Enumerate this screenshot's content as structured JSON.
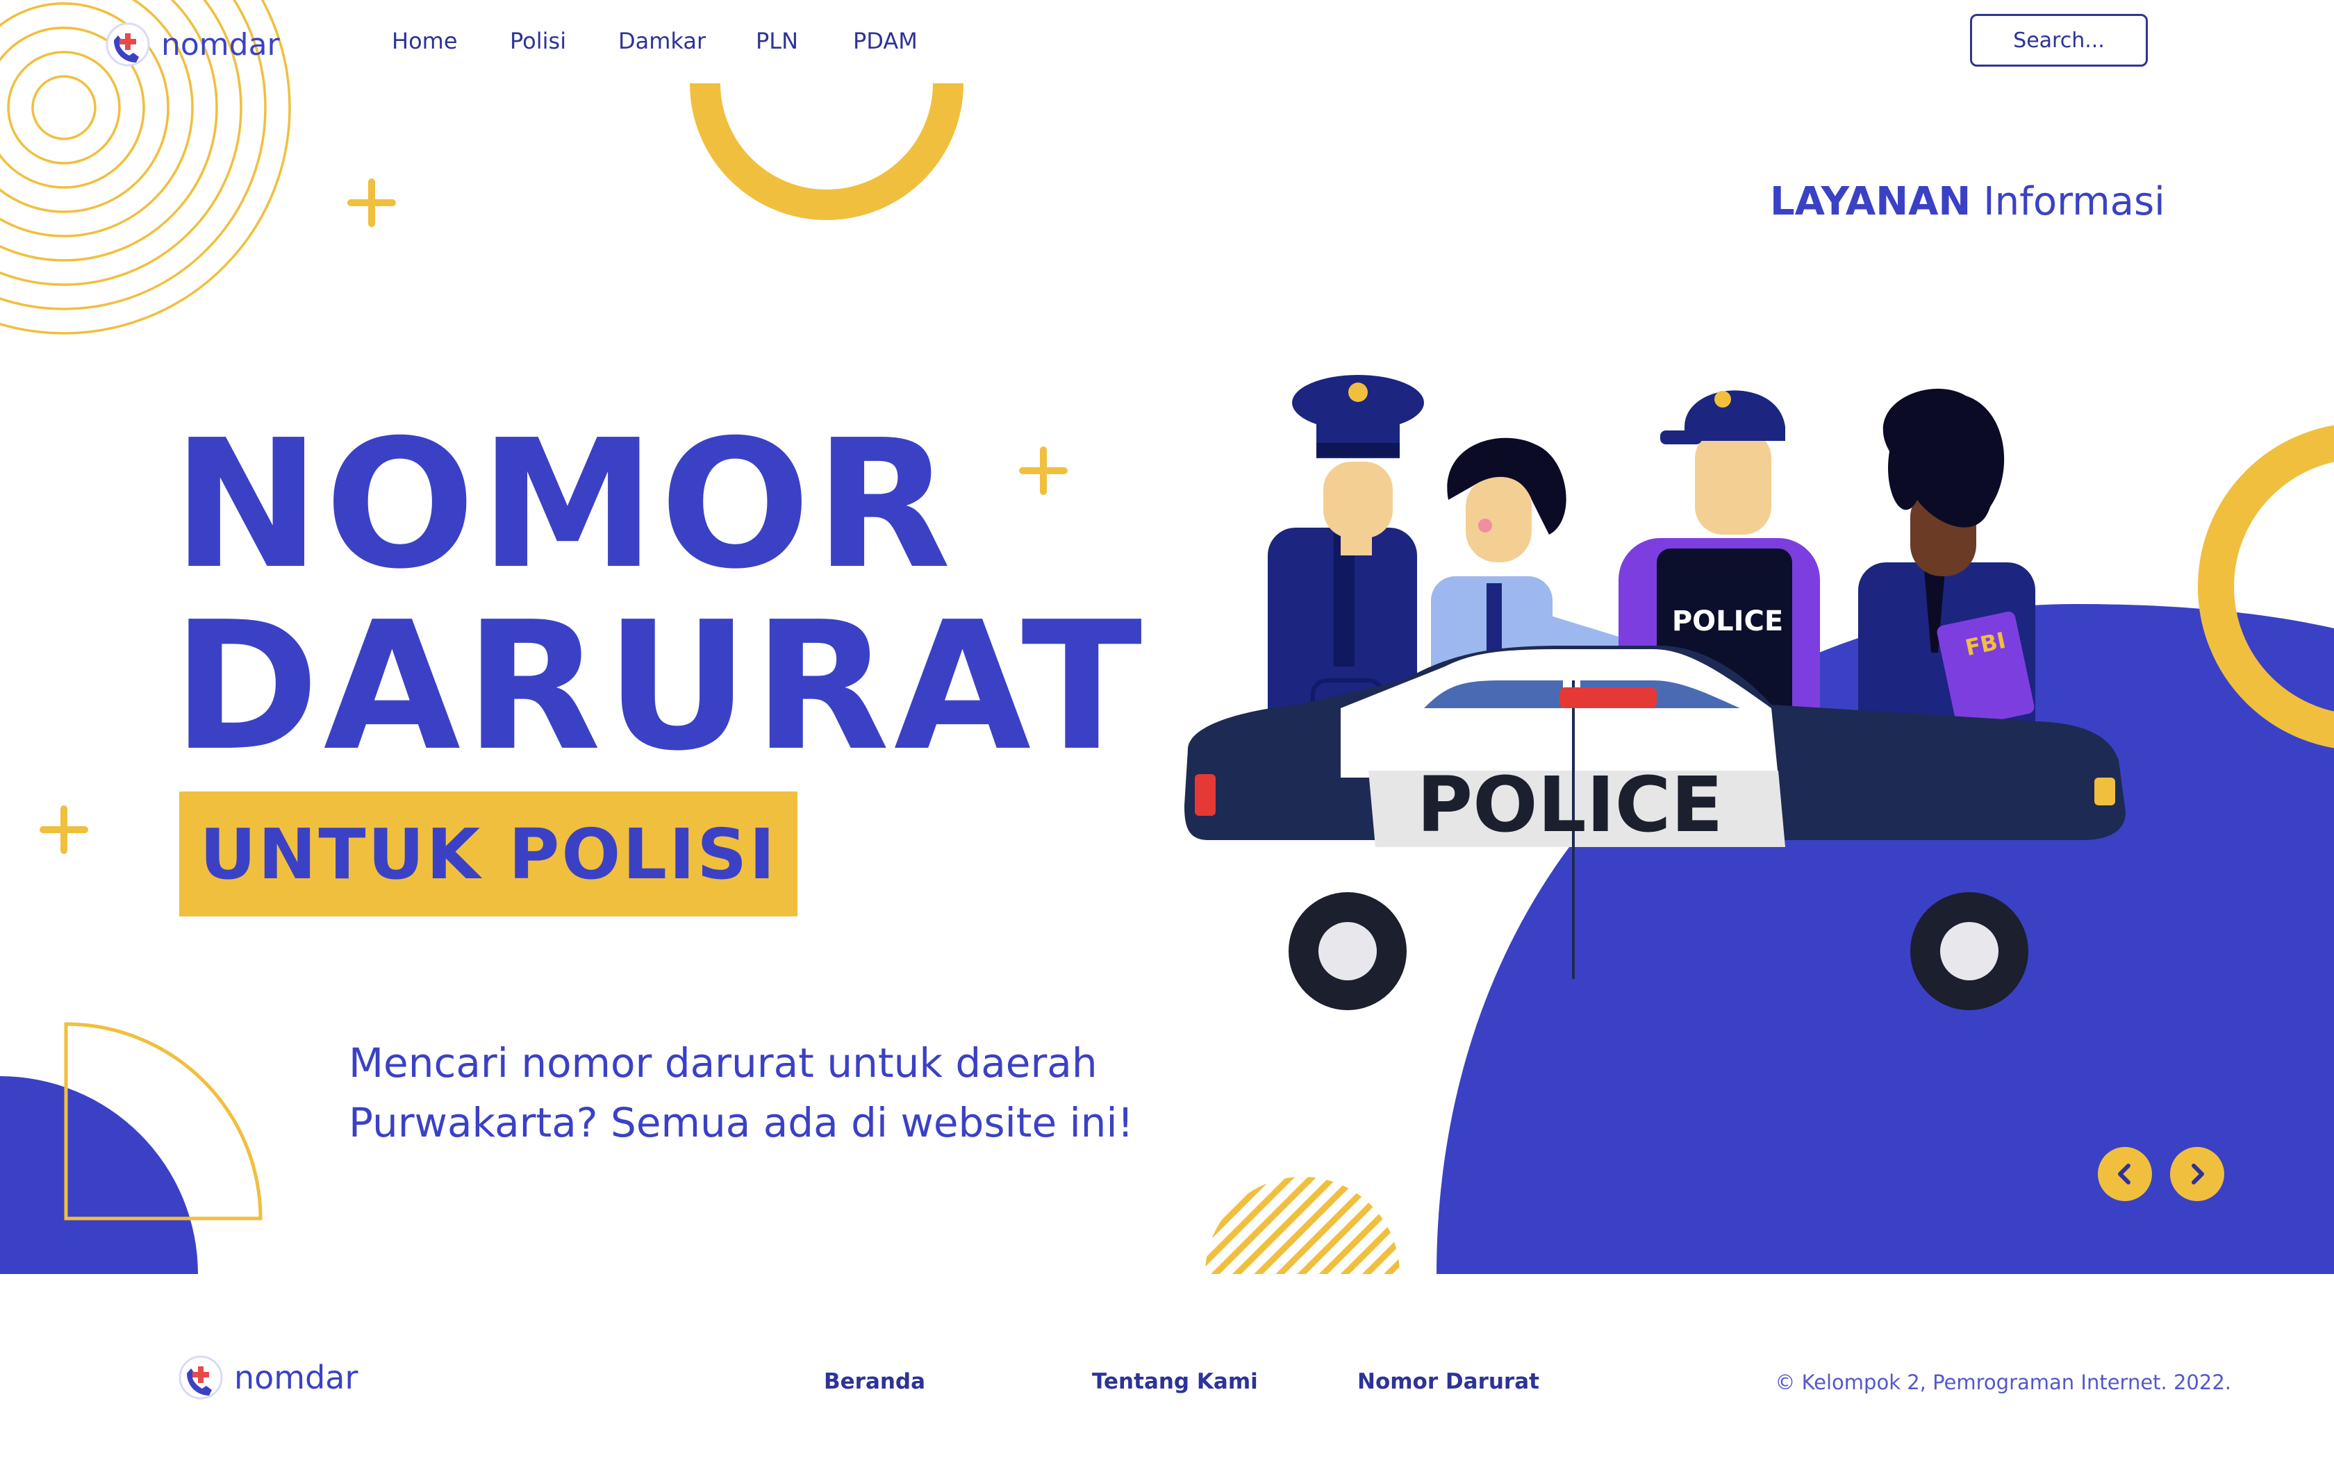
{
  "brand": {
    "name": "nomdar",
    "logo_icon": "phone-cross-icon"
  },
  "nav": {
    "items": [
      {
        "label": "Home"
      },
      {
        "label": "Polisi"
      },
      {
        "label": "Damkar"
      },
      {
        "label": "PLN"
      },
      {
        "label": "PDAM"
      }
    ],
    "search_placeholder": "Search..."
  },
  "hero": {
    "kicker_bold": "LAYANAN",
    "kicker_light": "Informasi",
    "title_line1": "NOMOR",
    "title_line2": "DARURAT",
    "tagline": "UNTUK POLISI",
    "subtitle_line1": "Mencari nomor darurat untuk daerah",
    "subtitle_line2": "Purwakarta? Semua ada di website ini!",
    "illustration": {
      "car_label": "POLICE",
      "vest_label": "POLICE",
      "folder_label": "FBI"
    }
  },
  "slider": {
    "prev_icon": "chevron-left-icon",
    "next_icon": "chevron-right-icon"
  },
  "footer": {
    "links": [
      {
        "label": "Beranda"
      },
      {
        "label": "Tentang Kami"
      },
      {
        "label": "Nomor Darurat"
      }
    ],
    "copyright": "© Kelompok 2, Pemrograman Internet. 2022."
  },
  "colors": {
    "primary_blue": "#3b41c5",
    "accent_yellow": "#f1bf3e",
    "nav_text": "#2d3397"
  }
}
